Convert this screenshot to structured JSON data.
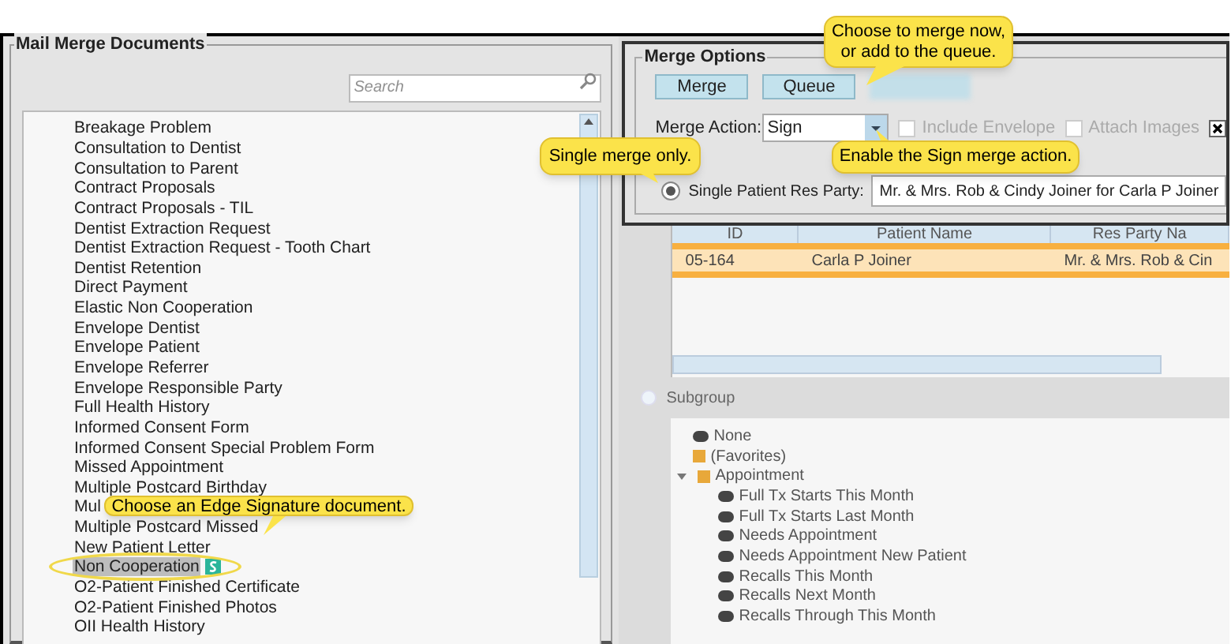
{
  "documents_panel": {
    "title": "Mail Merge Documents",
    "search": {
      "placeholder": "Search"
    },
    "items": [
      {
        "label": "Breakage Problem",
        "selected": false,
        "signature": false
      },
      {
        "label": "Consultation to Dentist",
        "selected": false,
        "signature": false
      },
      {
        "label": "Consultation to Parent",
        "selected": false,
        "signature": false
      },
      {
        "label": "Contract Proposals",
        "selected": false,
        "signature": false
      },
      {
        "label": "Contract Proposals - TIL",
        "selected": false,
        "signature": false
      },
      {
        "label": "Dentist Extraction Request",
        "selected": false,
        "signature": false
      },
      {
        "label": "Dentist Extraction Request - Tooth Chart",
        "selected": false,
        "signature": false
      },
      {
        "label": "Dentist Retention",
        "selected": false,
        "signature": false
      },
      {
        "label": "Direct Payment",
        "selected": false,
        "signature": false
      },
      {
        "label": "Elastic Non Cooperation",
        "selected": false,
        "signature": false
      },
      {
        "label": "Envelope Dentist",
        "selected": false,
        "signature": false
      },
      {
        "label": "Envelope Patient",
        "selected": false,
        "signature": false
      },
      {
        "label": "Envelope Referrer",
        "selected": false,
        "signature": false
      },
      {
        "label": "Envelope Responsible Party",
        "selected": false,
        "signature": false
      },
      {
        "label": "Full Health History",
        "selected": false,
        "signature": false
      },
      {
        "label": "Informed Consent Form",
        "selected": false,
        "signature": false
      },
      {
        "label": "Informed Consent Special Problem Form",
        "selected": false,
        "signature": false
      },
      {
        "label": "Missed Appointment",
        "selected": false,
        "signature": false
      },
      {
        "label": "Multiple Postcard Birthday",
        "selected": false,
        "signature": false
      },
      {
        "label": "Mul",
        "selected": false,
        "signature": false
      },
      {
        "label": "Multiple Postcard Missed",
        "selected": false,
        "signature": false
      },
      {
        "label": "New Patient Letter",
        "selected": false,
        "signature": false
      },
      {
        "label": "Non Cooperation",
        "selected": true,
        "signature": true
      },
      {
        "label": "O2-Patient Finished Certificate",
        "selected": false,
        "signature": false
      },
      {
        "label": "O2-Patient Finished Photos",
        "selected": false,
        "signature": false
      },
      {
        "label": "OII Health History",
        "selected": false,
        "signature": false
      }
    ]
  },
  "merge_options": {
    "title": "Merge Options",
    "buttons": [
      "Merge",
      "Queue"
    ],
    "merge_action": {
      "label": "Merge Action:",
      "value": "Sign"
    },
    "checkboxes": [
      {
        "label": "Include Envelope",
        "checked": false,
        "disabled": true
      },
      {
        "label": "Attach Images",
        "checked": false,
        "disabled": true
      },
      {
        "checked": true,
        "disabled": false
      }
    ],
    "single_patient": {
      "label": "Single Patient Res Party:",
      "selected": true,
      "value": "Mr. & Mrs. Rob & Cindy Joiner for Carla P Joiner"
    }
  },
  "patient_grid": {
    "columns": [
      "ID",
      "Patient Name",
      "Res Party Na"
    ],
    "rows": [
      {
        "cells": [
          "05-164",
          "Carla P Joiner",
          "Mr. & Mrs. Rob & Cin"
        ],
        "selected": true
      }
    ]
  },
  "subgroup": {
    "label": "Subgroup",
    "selected": false,
    "tree": [
      {
        "label": "None",
        "kind": "query"
      },
      {
        "label": "(Favorites)",
        "kind": "folder"
      },
      {
        "label": "Appointment",
        "kind": "folder",
        "expanded": true,
        "children": [
          {
            "label": "Full Tx Starts This Month",
            "kind": "query"
          },
          {
            "label": "Full Tx Starts Last Month",
            "kind": "query"
          },
          {
            "label": "Needs Appointment",
            "kind": "query"
          },
          {
            "label": "Needs Appointment New Patient",
            "kind": "query"
          },
          {
            "label": "Recalls This Month",
            "kind": "query"
          },
          {
            "label": "Recalls Next Month",
            "kind": "query"
          },
          {
            "label": "Recalls Through This Month",
            "kind": "query"
          }
        ]
      }
    ]
  },
  "callouts": [
    {
      "text": "Choose to merge now, or add to the queue."
    },
    {
      "text": "Single merge only."
    },
    {
      "text": "Enable the Sign merge action."
    },
    {
      "text": "Choose an Edge Signature document."
    }
  ]
}
